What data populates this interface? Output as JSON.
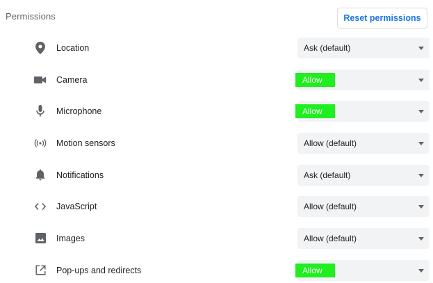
{
  "header": {
    "title": "Permissions",
    "reset_label": "Reset permissions"
  },
  "colors": {
    "accent": "#1a73e8",
    "highlight": "#1fee1f",
    "select_bg": "#f1f3f4",
    "icon": "#5f6368"
  },
  "permissions": [
    {
      "icon": "location-pin-icon",
      "label": "Location",
      "value": "Ask (default)",
      "highlighted": false
    },
    {
      "icon": "camera-icon",
      "label": "Camera",
      "value": "Allow",
      "highlighted": true
    },
    {
      "icon": "microphone-icon",
      "label": "Microphone",
      "value": "Allow",
      "highlighted": true
    },
    {
      "icon": "motion-sensors-icon",
      "label": "Motion sensors",
      "value": "Allow (default)",
      "highlighted": false
    },
    {
      "icon": "bell-icon",
      "label": "Notifications",
      "value": "Ask (default)",
      "highlighted": false
    },
    {
      "icon": "code-icon",
      "label": "JavaScript",
      "value": "Allow (default)",
      "highlighted": false
    },
    {
      "icon": "image-icon",
      "label": "Images",
      "value": "Allow (default)",
      "highlighted": false
    },
    {
      "icon": "open-in-new-icon",
      "label": "Pop-ups and redirects",
      "value": "Allow",
      "highlighted": true
    }
  ]
}
